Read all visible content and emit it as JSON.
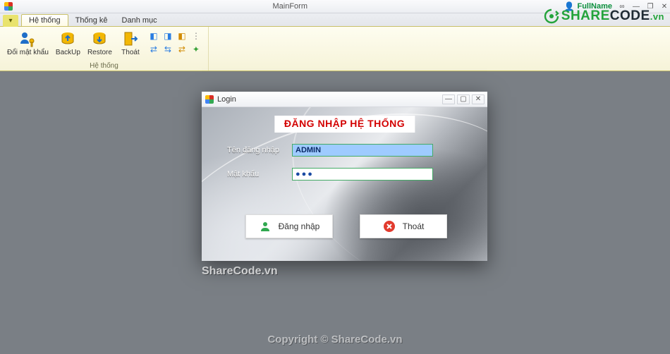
{
  "window": {
    "title": "MainForm",
    "user_name": "FullName"
  },
  "ribbon": {
    "tabs": [
      "Hệ thống",
      "Thống kê",
      "Danh mục"
    ],
    "active_tab": 0,
    "group_label": "Hệ thống",
    "buttons": {
      "change_pw": "Đổi mật\nkhẩu",
      "backup": "BackUp",
      "restore": "Restore",
      "exit": "Thoát"
    }
  },
  "login": {
    "title": "Login",
    "heading": "ĐĂNG NHẬP HỆ THỐNG",
    "username_label": "Tên đăng nhập",
    "username_value": "ADMIN",
    "password_label": "Mật khẩu",
    "password_value": "●●●",
    "login_btn": "Đăng nhập",
    "exit_btn": "Thoát"
  },
  "watermark": {
    "wm1": "ShareCode.vn",
    "wm2": "Copyright © ShareCode.vn",
    "logo_a": "SHARE",
    "logo_b": "CODE",
    "logo_c": ".vn"
  }
}
